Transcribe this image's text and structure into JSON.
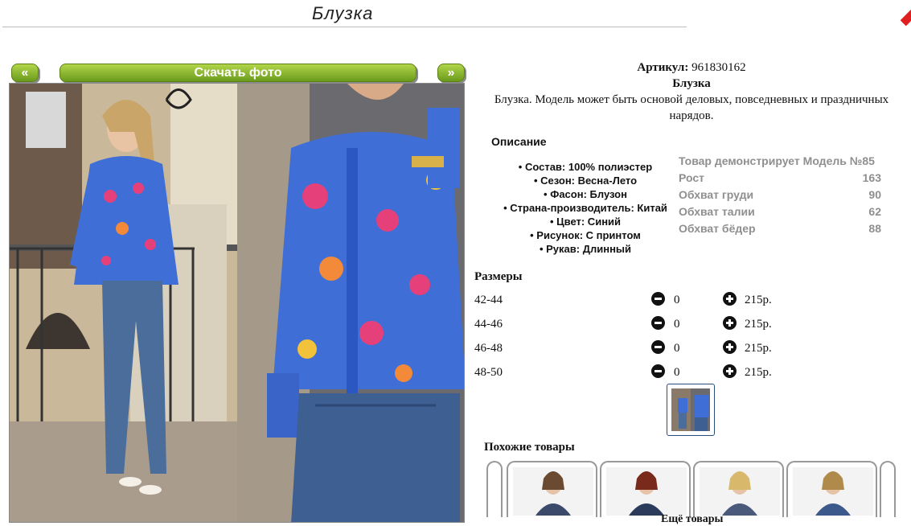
{
  "header": {
    "title": "Блузка"
  },
  "gallery": {
    "prev_label": "«",
    "next_label": "»",
    "download_label": "Скачать фото"
  },
  "product": {
    "article_label": "Артикул:",
    "article_value": "961830162",
    "name": "Блузка",
    "description": "Блузка. Модель может быть основой деловых, повседневных и праздничных нарядов."
  },
  "details": {
    "heading": "Описание",
    "items": [
      "Состав: 100% полиэстер",
      "Сезон: Весна-Лето",
      "Фасон: Блузон",
      "Страна-производитель: Китай",
      "Цвет: Синий",
      "Рисунок: С принтом",
      "Рукав: Длинный"
    ]
  },
  "model": {
    "rows": [
      {
        "label": "Товар демонстрирует Модель №85",
        "value": ""
      },
      {
        "label": "Рост",
        "value": "163"
      },
      {
        "label": "Обхват груди",
        "value": "90"
      },
      {
        "label": "Обхват талии",
        "value": "62"
      },
      {
        "label": "Обхват бёдер",
        "value": "88"
      }
    ]
  },
  "sizes": {
    "heading": "Размеры",
    "rows": [
      {
        "size": "42-44",
        "qty": "0",
        "price": "215р."
      },
      {
        "size": "44-46",
        "qty": "0",
        "price": "215р."
      },
      {
        "size": "46-48",
        "qty": "0",
        "price": "215р."
      },
      {
        "size": "48-50",
        "qty": "0",
        "price": "215р."
      }
    ]
  },
  "similar": {
    "heading": "Похожие товары"
  },
  "footer": {
    "text": "Ещё товары"
  },
  "colors": {
    "button_green": "#7fae24",
    "model_gray": "#8f8f8f",
    "shirt_blue": "#3f6fd6"
  }
}
